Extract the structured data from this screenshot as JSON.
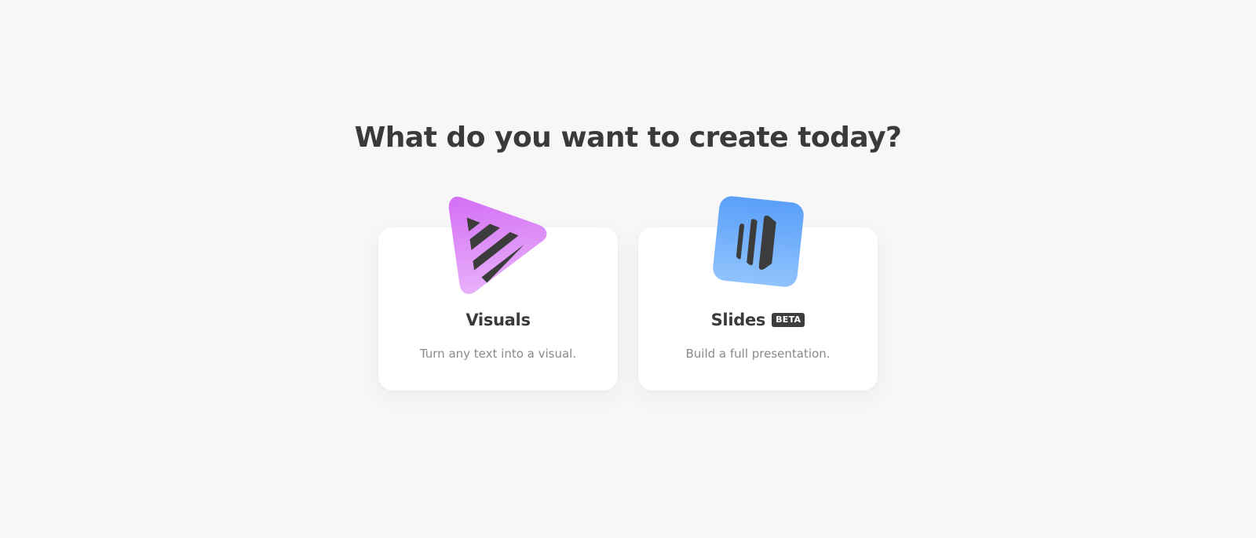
{
  "headline": "What do you want to create today?",
  "options": [
    {
      "title": "Visuals",
      "description": "Turn any text into a visual.",
      "icon": "visuals-play-icon",
      "icon_colors": [
        "#d876f4",
        "#e6a8fa"
      ]
    },
    {
      "title": "Slides",
      "badge": "BETA",
      "description": "Build a full presentation.",
      "icon": "slides-icon",
      "icon_colors": [
        "#5ea3fa",
        "#8cc0fc"
      ]
    }
  ],
  "colors": {
    "background": "#f7f7f7",
    "card": "#ffffff",
    "text_dark": "#3a3a3a",
    "text_muted": "#8a8a8a",
    "badge_bg": "#3d3d3d"
  }
}
